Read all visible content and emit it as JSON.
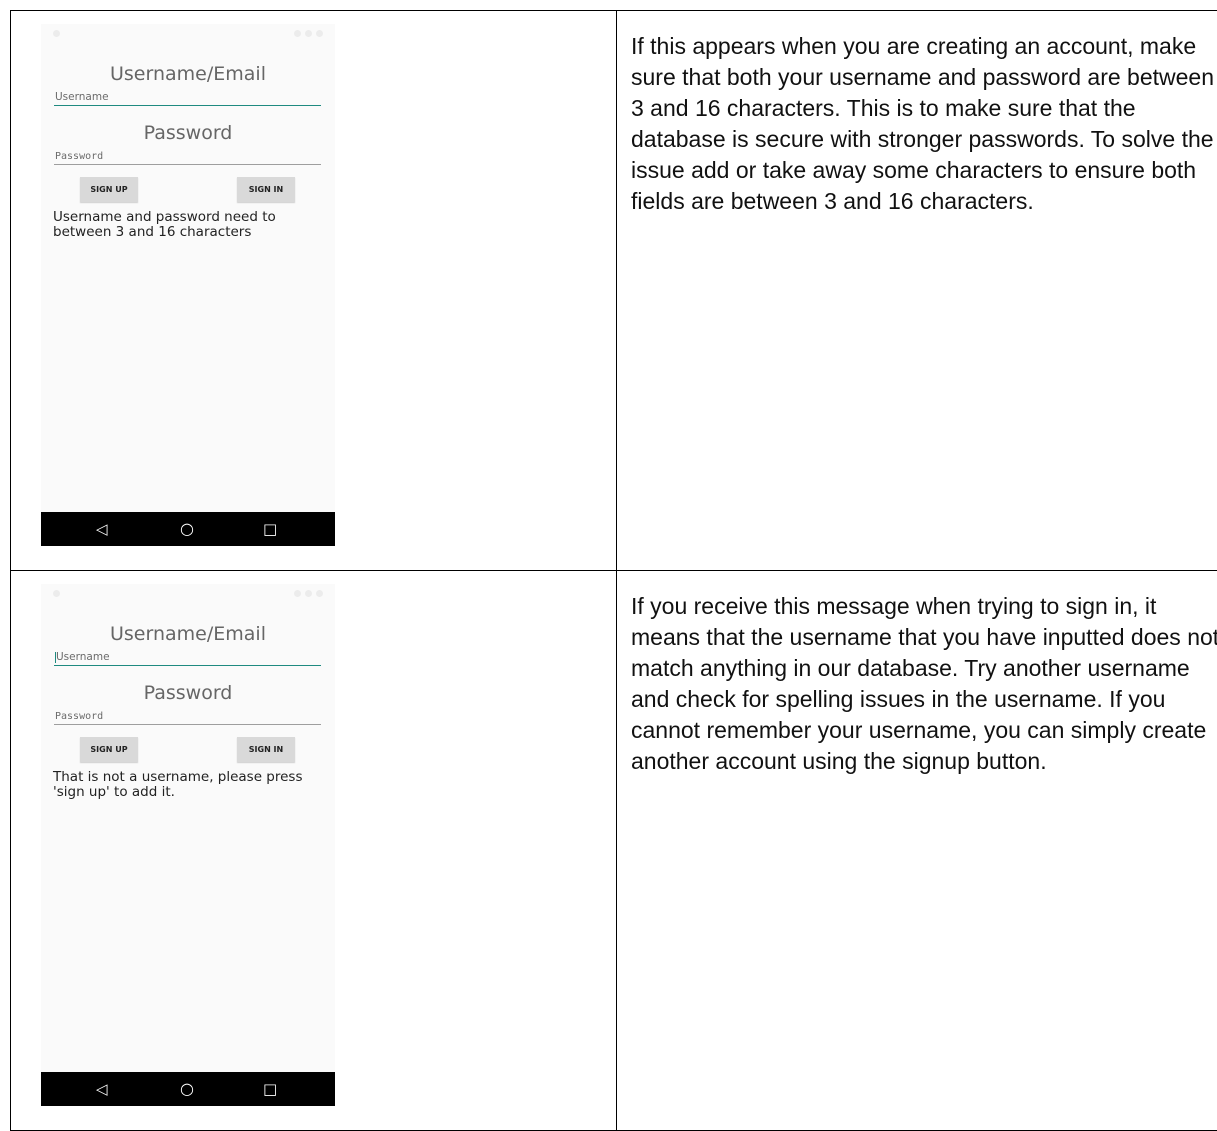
{
  "rows": [
    {
      "screen": {
        "username_heading": "Username/Email",
        "username_placeholder": "Username",
        "password_heading": "Password",
        "password_placeholder": "Password",
        "sign_up_label": "SIGN UP",
        "sign_in_label": "SIGN IN",
        "message": "Username and password need to between 3 and 16 characters",
        "nav": {
          "back": "◁",
          "home": "○",
          "recent": "□"
        }
      },
      "explanation": "If this appears when you are creating an account, make sure that both your username and password are between 3 and 16 characters. This is to make sure that the database is secure with stronger passwords. To solve the issue add or take away some characters to ensure both fields are between 3 and 16 characters."
    },
    {
      "screen": {
        "username_heading": "Username/Email",
        "username_placeholder": "Username",
        "password_heading": "Password",
        "password_placeholder": "Password",
        "sign_up_label": "SIGN UP",
        "sign_in_label": "SIGN IN",
        "message": "That is not a username, please press 'sign up' to add it.",
        "nav": {
          "back": "◁",
          "home": "○",
          "recent": "□"
        }
      },
      "explanation": "If you receive this message when trying to sign in, it means that the username that you have inputted does not match anything in our database. Try another username and check for spelling issues in the username. If you cannot remember your username, you can simply create another account using the signup button."
    }
  ]
}
